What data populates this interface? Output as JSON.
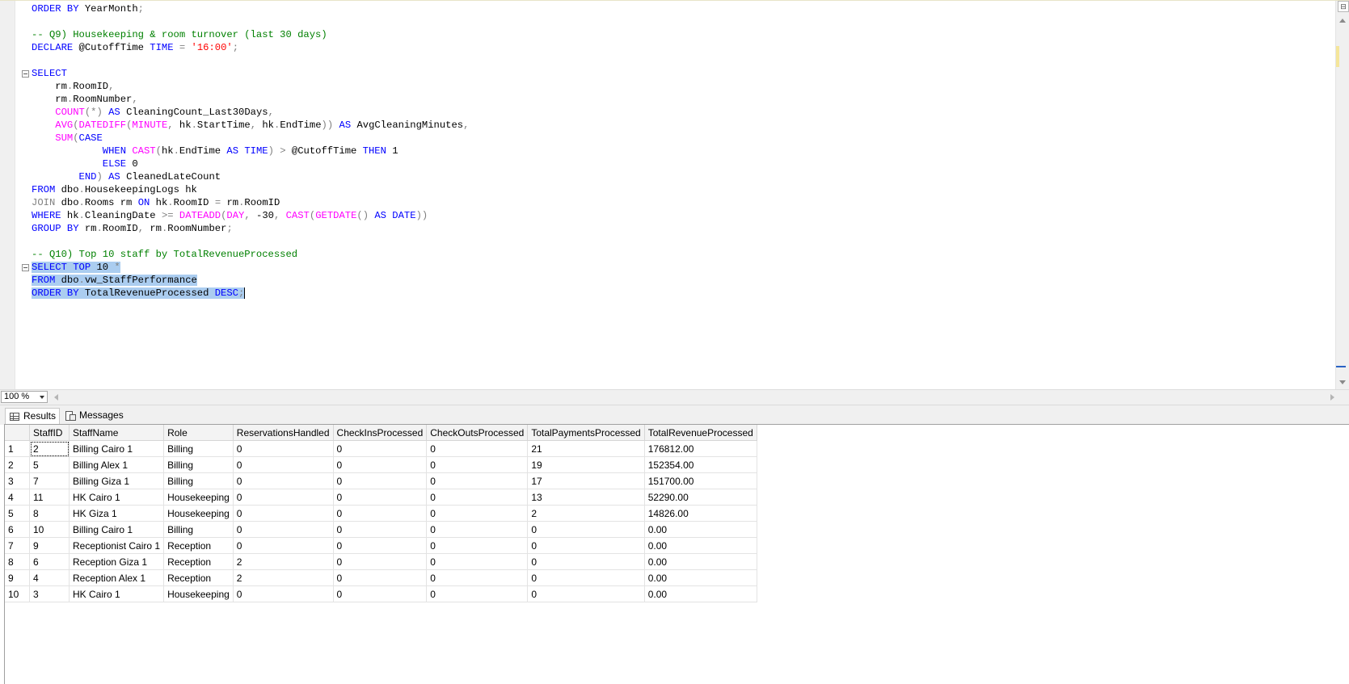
{
  "editor": {
    "lines": [
      [
        [
          "kw",
          "ORDER BY "
        ],
        [
          "t",
          "YearMonth"
        ],
        [
          "op",
          ";"
        ]
      ],
      [],
      [
        [
          "cm",
          "-- Q9) Housekeeping & room turnover (last 30 days)"
        ]
      ],
      [
        [
          "kw",
          "DECLARE "
        ],
        [
          "t",
          "@CutoffTime "
        ],
        [
          "kw",
          "TIME "
        ],
        [
          "op",
          "= "
        ],
        [
          "str",
          "'16:00'"
        ],
        [
          "op",
          ";"
        ]
      ],
      [],
      [
        [
          "kw",
          "SELECT"
        ]
      ],
      [
        [
          "t",
          "    rm"
        ],
        [
          "op",
          "."
        ],
        [
          "t",
          "RoomID"
        ],
        [
          "op",
          ","
        ]
      ],
      [
        [
          "t",
          "    rm"
        ],
        [
          "op",
          "."
        ],
        [
          "t",
          "RoomNumber"
        ],
        [
          "op",
          ","
        ]
      ],
      [
        [
          "t",
          "    "
        ],
        [
          "fn",
          "COUNT"
        ],
        [
          "op",
          "(*) "
        ],
        [
          "kw",
          "AS "
        ],
        [
          "t",
          "CleaningCount_Last30Days"
        ],
        [
          "op",
          ","
        ]
      ],
      [
        [
          "t",
          "    "
        ],
        [
          "fn",
          "AVG"
        ],
        [
          "op",
          "("
        ],
        [
          "fn",
          "DATEDIFF"
        ],
        [
          "op",
          "("
        ],
        [
          "fn",
          "MINUTE"
        ],
        [
          "op",
          ", "
        ],
        [
          "t",
          "hk"
        ],
        [
          "op",
          "."
        ],
        [
          "t",
          "StartTime"
        ],
        [
          "op",
          ", "
        ],
        [
          "t",
          "hk"
        ],
        [
          "op",
          "."
        ],
        [
          "t",
          "EndTime"
        ],
        [
          "op",
          "))"
        ],
        [
          "t",
          " "
        ],
        [
          "kw",
          "AS "
        ],
        [
          "t",
          "AvgCleaningMinutes"
        ],
        [
          "op",
          ","
        ]
      ],
      [
        [
          "t",
          "    "
        ],
        [
          "fn",
          "SUM"
        ],
        [
          "op",
          "("
        ],
        [
          "kw",
          "CASE"
        ]
      ],
      [
        [
          "t",
          "            "
        ],
        [
          "kw",
          "WHEN "
        ],
        [
          "fn",
          "CAST"
        ],
        [
          "op",
          "("
        ],
        [
          "t",
          "hk"
        ],
        [
          "op",
          "."
        ],
        [
          "t",
          "EndTime "
        ],
        [
          "kw",
          "AS TIME"
        ],
        [
          "op",
          ") > "
        ],
        [
          "t",
          "@CutoffTime "
        ],
        [
          "kw",
          "THEN "
        ],
        [
          "t",
          "1"
        ]
      ],
      [
        [
          "t",
          "            "
        ],
        [
          "kw",
          "ELSE "
        ],
        [
          "t",
          "0"
        ]
      ],
      [
        [
          "t",
          "        "
        ],
        [
          "kw",
          "END"
        ],
        [
          "op",
          ") "
        ],
        [
          "kw",
          "AS "
        ],
        [
          "t",
          "CleanedLateCount"
        ]
      ],
      [
        [
          "kw",
          "FROM "
        ],
        [
          "t",
          "dbo"
        ],
        [
          "op",
          "."
        ],
        [
          "t",
          "HousekeepingLogs hk"
        ]
      ],
      [
        [
          "op",
          "JOIN "
        ],
        [
          "t",
          "dbo"
        ],
        [
          "op",
          "."
        ],
        [
          "t",
          "Rooms rm "
        ],
        [
          "kw",
          "ON "
        ],
        [
          "t",
          "hk"
        ],
        [
          "op",
          "."
        ],
        [
          "t",
          "RoomID "
        ],
        [
          "op",
          "= "
        ],
        [
          "t",
          "rm"
        ],
        [
          "op",
          "."
        ],
        [
          "t",
          "RoomID"
        ]
      ],
      [
        [
          "kw",
          "WHERE "
        ],
        [
          "t",
          "hk"
        ],
        [
          "op",
          "."
        ],
        [
          "t",
          "CleaningDate "
        ],
        [
          "op",
          ">= "
        ],
        [
          "fn",
          "DATEADD"
        ],
        [
          "op",
          "("
        ],
        [
          "fn",
          "DAY"
        ],
        [
          "op",
          ", "
        ],
        [
          "t",
          "-30"
        ],
        [
          "op",
          ", "
        ],
        [
          "fn",
          "CAST"
        ],
        [
          "op",
          "("
        ],
        [
          "fn",
          "GETDATE"
        ],
        [
          "op",
          "() "
        ],
        [
          "kw",
          "AS DATE"
        ],
        [
          "op",
          "))"
        ]
      ],
      [
        [
          "kw",
          "GROUP BY "
        ],
        [
          "t",
          "rm"
        ],
        [
          "op",
          "."
        ],
        [
          "t",
          "RoomID"
        ],
        [
          "op",
          ", "
        ],
        [
          "t",
          "rm"
        ],
        [
          "op",
          "."
        ],
        [
          "t",
          "RoomNumber"
        ],
        [
          "op",
          ";"
        ]
      ],
      [],
      [
        [
          "cm",
          "-- Q10) Top 10 staff by TotalRevenueProcessed"
        ]
      ],
      [
        [
          "kw",
          "SELECT TOP "
        ],
        [
          "t",
          "10 "
        ],
        [
          "op",
          "*"
        ]
      ],
      [
        [
          "kw",
          "FROM "
        ],
        [
          "t",
          "dbo"
        ],
        [
          "op",
          "."
        ],
        [
          "t",
          "vw_StaffPerformance"
        ]
      ],
      [
        [
          "kw",
          "ORDER BY "
        ],
        [
          "t",
          "TotalRevenueProcessed "
        ],
        [
          "kw",
          "DESC"
        ],
        [
          "op",
          ";"
        ]
      ]
    ],
    "selected_lines": [
      20,
      21,
      22
    ],
    "fold_lines": [
      5,
      20
    ]
  },
  "zoom": {
    "level": "100 %"
  },
  "tabs": {
    "results": "Results",
    "messages": "Messages"
  },
  "grid": {
    "columns": [
      "StaffID",
      "StaffName",
      "Role",
      "ReservationsHandled",
      "CheckInsProcessed",
      "CheckOutsProcessed",
      "TotalPaymentsProcessed",
      "TotalRevenueProcessed"
    ],
    "rows": [
      [
        "1",
        "2",
        "Billing Cairo 1",
        "Billing",
        "0",
        "0",
        "0",
        "21",
        "176812.00"
      ],
      [
        "2",
        "5",
        "Billing Alex 1",
        "Billing",
        "0",
        "0",
        "0",
        "19",
        "152354.00"
      ],
      [
        "3",
        "7",
        "Billing Giza 1",
        "Billing",
        "0",
        "0",
        "0",
        "17",
        "151700.00"
      ],
      [
        "4",
        "11",
        "HK Cairo 1",
        "Housekeeping",
        "0",
        "0",
        "0",
        "13",
        "52290.00"
      ],
      [
        "5",
        "8",
        "HK Giza 1",
        "Housekeeping",
        "0",
        "0",
        "0",
        "2",
        "14826.00"
      ],
      [
        "6",
        "10",
        "Billing Cairo 1",
        "Billing",
        "0",
        "0",
        "0",
        "0",
        "0.00"
      ],
      [
        "7",
        "9",
        "Receptionist Cairo 1",
        "Reception",
        "0",
        "0",
        "0",
        "0",
        "0.00"
      ],
      [
        "8",
        "6",
        "Reception Giza 1",
        "Reception",
        "2",
        "0",
        "0",
        "0",
        "0.00"
      ],
      [
        "9",
        "4",
        "Reception Alex 1",
        "Reception",
        "2",
        "0",
        "0",
        "0",
        "0.00"
      ],
      [
        "10",
        "3",
        "HK Cairo 1",
        "Housekeeping",
        "0",
        "0",
        "0",
        "0",
        "0.00"
      ]
    ]
  }
}
